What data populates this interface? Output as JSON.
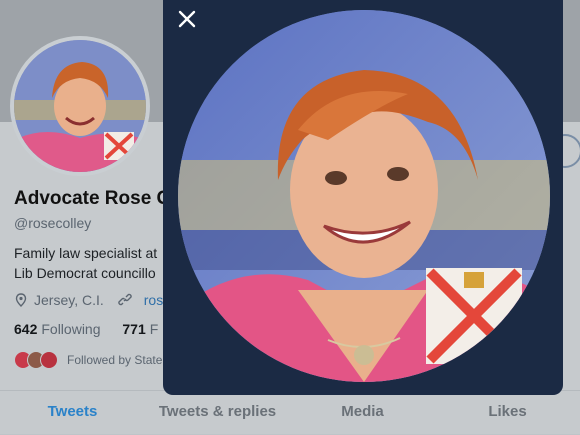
{
  "profile": {
    "display_name": "Advocate Rose C",
    "handle": "@rosecolley",
    "bio_line1": "Family law specialist at",
    "bio_line2": "Lib Democrat councillo",
    "location": "Jersey, C.I.",
    "website": "rose",
    "following_count": "642",
    "following_label": "Following",
    "followers_count": "771",
    "followers_label": "F",
    "followed_by": "Followed by State"
  },
  "tabs": [
    {
      "label": "Tweets",
      "active": true
    },
    {
      "label": "Tweets & replies",
      "active": false
    },
    {
      "label": "Media",
      "active": false
    },
    {
      "label": "Likes",
      "active": false
    }
  ],
  "overlay": {
    "close_icon": "close-icon"
  },
  "colors": {
    "accent": "#2a82c9",
    "overlay_bg": "#1b2a44",
    "flag_red": "#e4473a"
  }
}
